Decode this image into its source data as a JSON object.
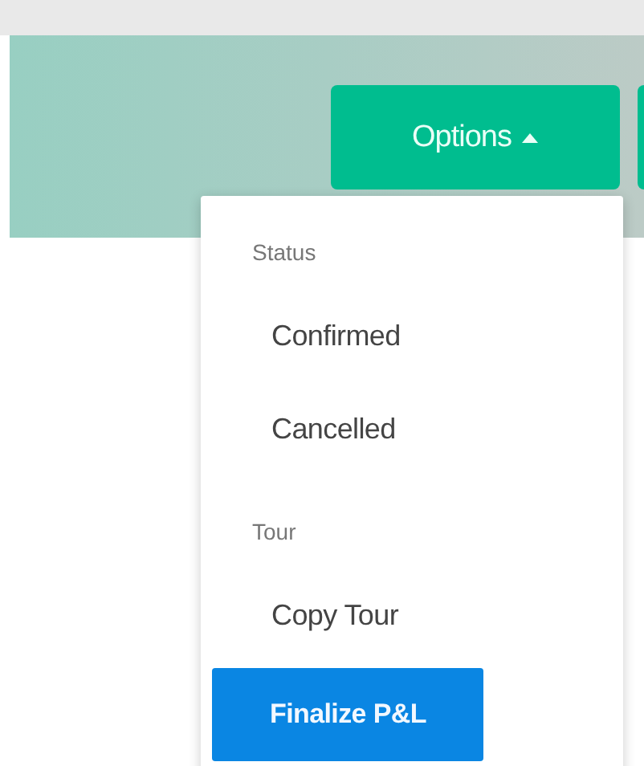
{
  "options_button": {
    "label": "Options",
    "expanded": true
  },
  "menu": [
    {
      "header": "Status",
      "items": [
        {
          "label": "Confirmed",
          "selected": false
        },
        {
          "label": "Cancelled",
          "selected": false
        }
      ]
    },
    {
      "header": "Tour",
      "items": [
        {
          "label": "Copy Tour",
          "selected": false
        },
        {
          "label": "Finalize P&L",
          "selected": true
        }
      ]
    }
  ]
}
